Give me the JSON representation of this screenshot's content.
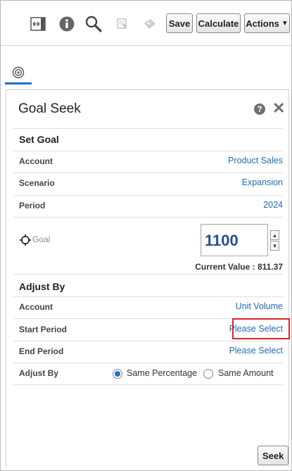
{
  "toolbar": {
    "icons": [
      "fit-width-icon",
      "info-icon",
      "search-icon",
      "filter-icon",
      "gift-icon"
    ],
    "save_label": "Save",
    "calculate_label": "Calculate",
    "actions_label": "Actions"
  },
  "panel": {
    "title": "Goal Seek"
  },
  "set_goal": {
    "title": "Set Goal",
    "rows": [
      {
        "label": "Account",
        "value": "Product Sales"
      },
      {
        "label": "Scenario",
        "value": "Expansion"
      },
      {
        "label": "Period",
        "value": "2024"
      }
    ],
    "goal_label": "Goal",
    "goal_value": "1100",
    "current_value": "Current Value : 811.37"
  },
  "adjust_by": {
    "title": "Adjust By",
    "rows": [
      {
        "label": "Account",
        "value": "Unit Volume"
      },
      {
        "label": "Start Period",
        "value": "Please Select"
      },
      {
        "label": "End Period",
        "value": "Please Select"
      }
    ],
    "adjust_label": "Adjust By",
    "options": [
      {
        "label": "Same Percentage",
        "selected": true
      },
      {
        "label": "Same Amount",
        "selected": false
      }
    ]
  },
  "seek_label": "Seek",
  "colors": {
    "link": "#1f6bb5",
    "accent": "#1a73c9",
    "highlight": "#d6262b",
    "goal_text": "#2a4d8c"
  }
}
